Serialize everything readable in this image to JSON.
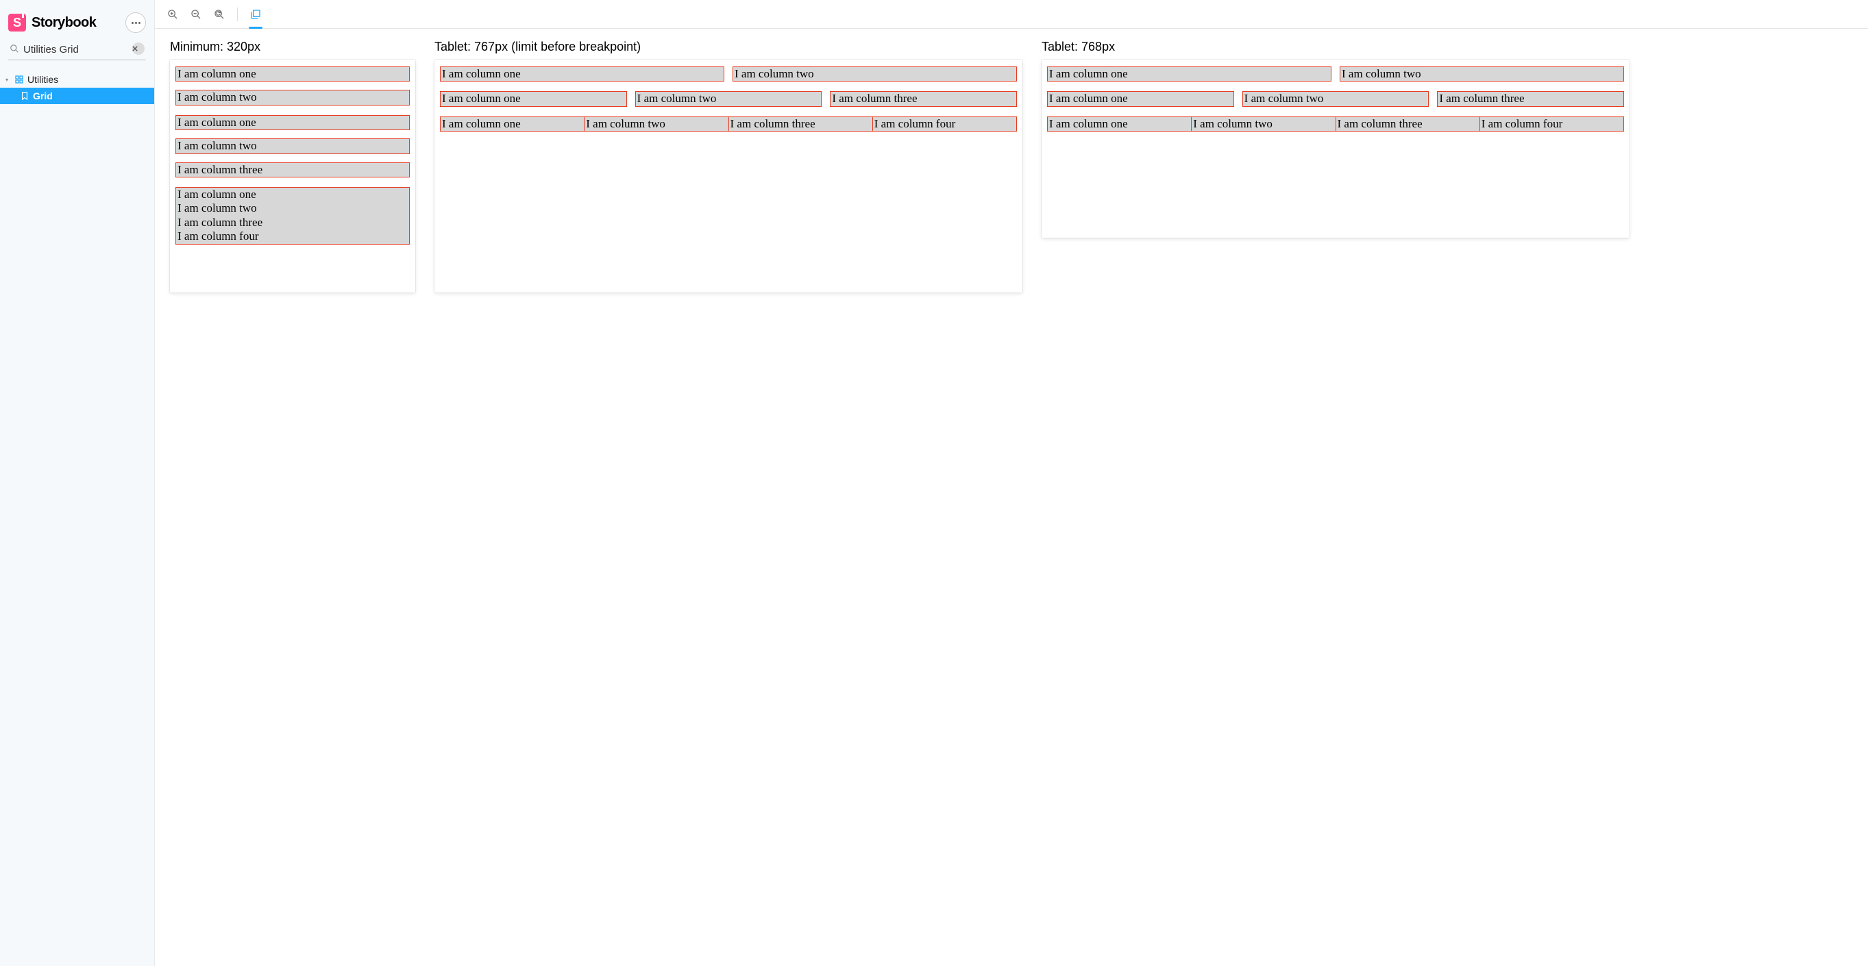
{
  "app": {
    "name": "Storybook"
  },
  "search": {
    "value": "Utilities Grid"
  },
  "tree": {
    "root": {
      "label": "Utilities"
    },
    "child": {
      "label": "Grid"
    }
  },
  "viewports": {
    "min": {
      "title": "Minimum: 320px"
    },
    "tab767": {
      "title": "Tablet: 767px (limit before breakpoint)"
    },
    "tab768": {
      "title": "Tablet: 768px"
    }
  },
  "cols": {
    "one": "I am column one",
    "two": "I am column two",
    "three": "I am column three",
    "four": "I am column four"
  }
}
